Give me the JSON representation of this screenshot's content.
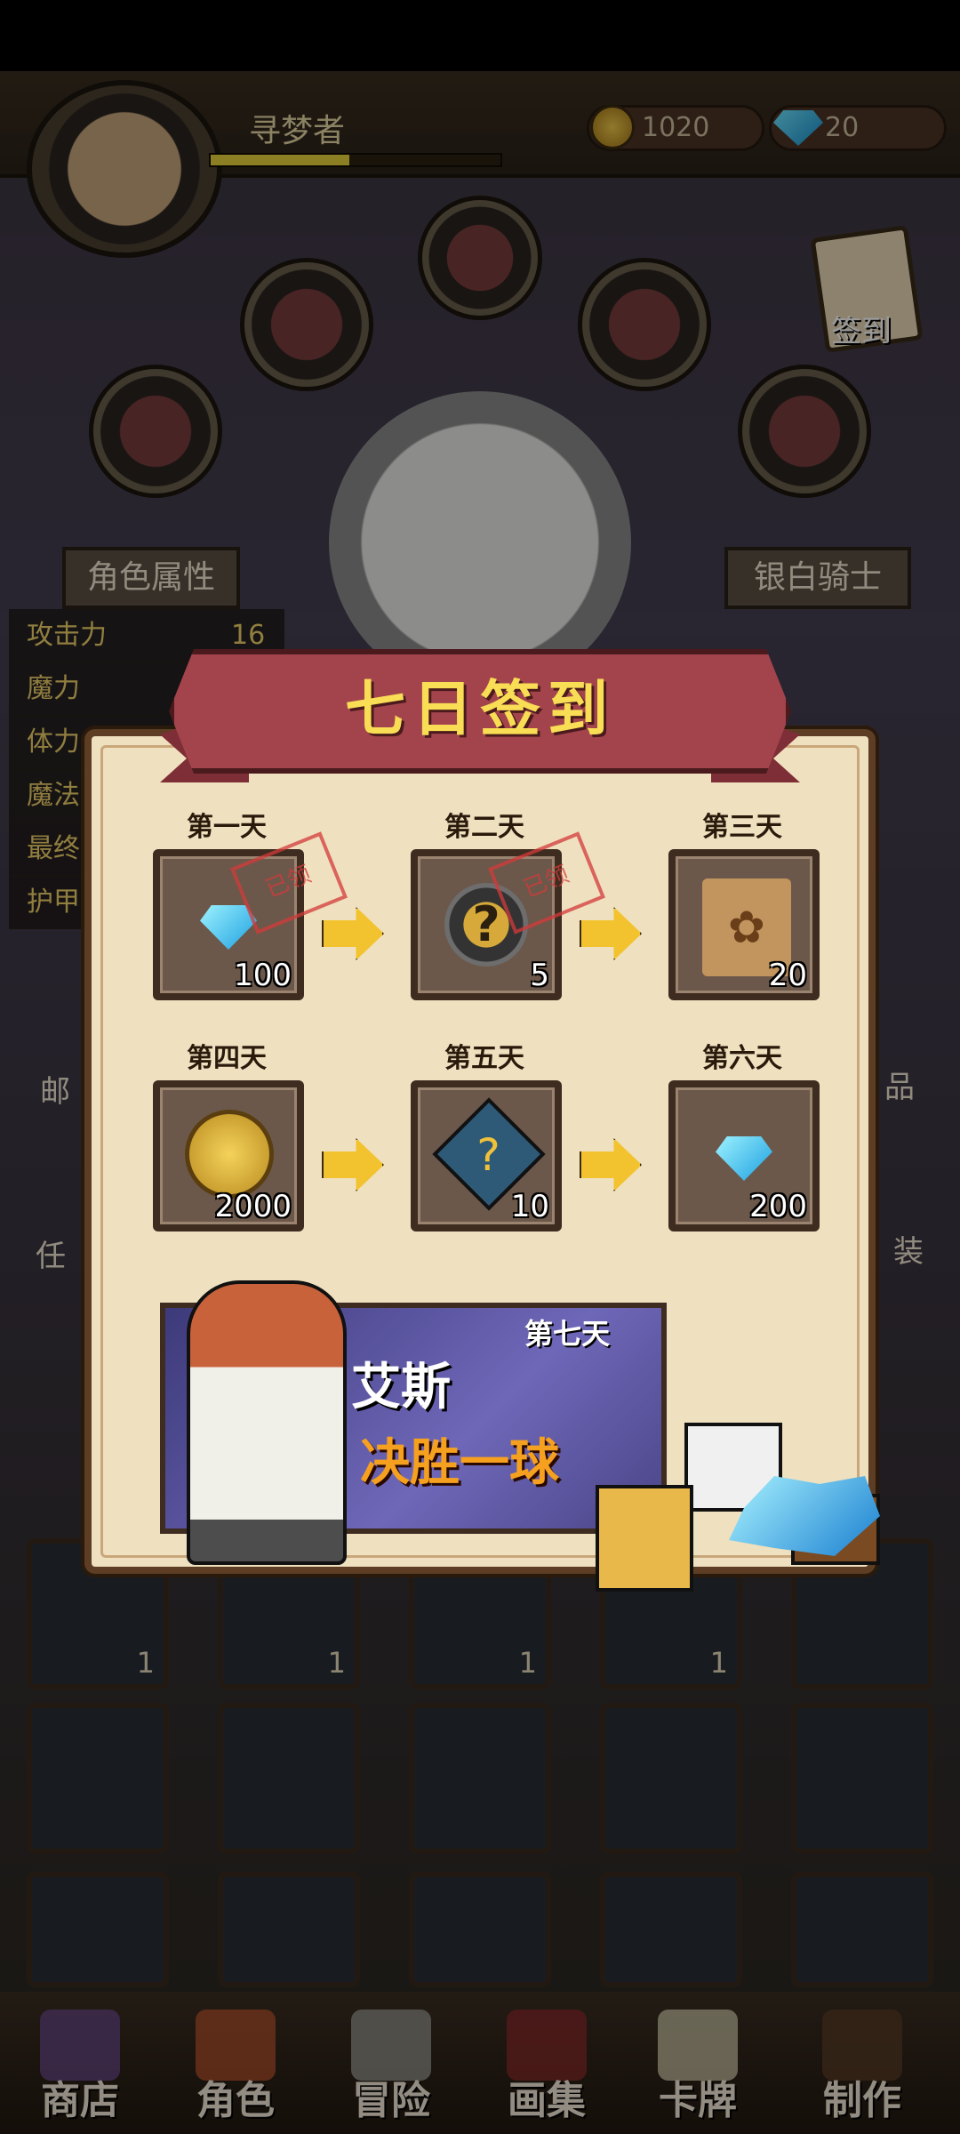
{
  "player": {
    "name": "寻梦者",
    "xp_fraction": 0.48
  },
  "currency": {
    "coins": "1020",
    "gems": "20"
  },
  "checkin_button": {
    "label": "签到"
  },
  "left_panel": {
    "title": "角色属性",
    "stats": [
      {
        "label": "攻击力",
        "value": "16"
      },
      {
        "label": "魔力",
        "value": ""
      },
      {
        "label": "体力",
        "value": ""
      },
      {
        "label": "魔法",
        "value": ""
      },
      {
        "label": "最终",
        "value": ""
      },
      {
        "label": "护甲",
        "value": ""
      }
    ]
  },
  "right_panel": {
    "title": "银白骑士"
  },
  "side_buttons": {
    "mail": "邮",
    "task": "任",
    "item": "品",
    "outfit": "装"
  },
  "slot_levels": [
    "1",
    "1",
    "1",
    "1"
  ],
  "dialog": {
    "title": "七日签到",
    "stamp_text": "已领",
    "days": [
      {
        "label": "第一天",
        "reward": "gem",
        "quantity": "100",
        "claimed": true
      },
      {
        "label": "第二天",
        "reward": "mystery-card",
        "quantity": "5",
        "claimed": true
      },
      {
        "label": "第三天",
        "reward": "paw-bag",
        "quantity": "20",
        "claimed": false
      },
      {
        "label": "第四天",
        "reward": "coin",
        "quantity": "2000",
        "claimed": false
      },
      {
        "label": "第五天",
        "reward": "mystery-puzzle",
        "quantity": "10",
        "claimed": false
      },
      {
        "label": "第六天",
        "reward": "gem",
        "quantity": "200",
        "claimed": false
      }
    ],
    "day7": {
      "label": "第七天",
      "hero_name": "艾斯",
      "skill_name": "决胜一球"
    }
  },
  "nav": [
    {
      "label": "商店",
      "icon": "castle-icon"
    },
    {
      "label": "角色",
      "icon": "cat-icon"
    },
    {
      "label": "冒险",
      "icon": "swords-icon"
    },
    {
      "label": "画集",
      "icon": "book-icon"
    },
    {
      "label": "卡牌",
      "icon": "card-icon"
    },
    {
      "label": "制作",
      "icon": "hammer-icon"
    }
  ],
  "colors": {
    "accent_gold": "#f8dd55",
    "banner_red": "#a3444d",
    "dialog_paper": "#efe0bf",
    "skill_orange": "#f6a020"
  }
}
